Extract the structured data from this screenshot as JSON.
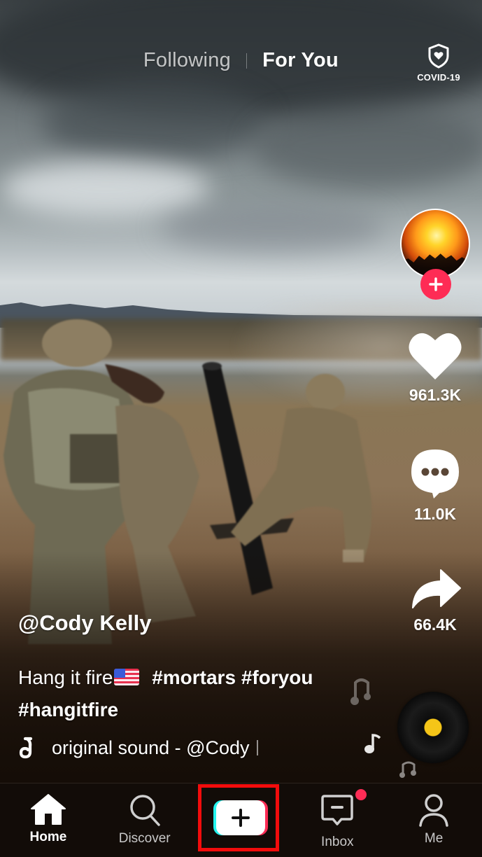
{
  "top_nav": {
    "tabs": [
      {
        "label": "Following",
        "active": false
      },
      {
        "label": "For You",
        "active": true
      }
    ],
    "covid_label": "COVID-19"
  },
  "creator": {
    "username": "@Cody Kelly",
    "follow_icon": "plus-icon"
  },
  "actions": {
    "likes": "961.3K",
    "comments": "11.0K",
    "shares": "66.4K"
  },
  "post": {
    "caption_text": "Hang it fire",
    "caption_emoji": "us-flag",
    "hashtags": [
      "#mortars",
      "#foryou",
      "#hangitfire"
    ],
    "sound": "original sound - @Cody"
  },
  "bottom_nav": {
    "items": [
      {
        "label": "Home",
        "icon": "home-icon",
        "active": true
      },
      {
        "label": "Discover",
        "icon": "search-icon",
        "active": false
      },
      {
        "label": "",
        "icon": "create-plus-icon",
        "active": false
      },
      {
        "label": "Inbox",
        "icon": "inbox-icon",
        "active": false,
        "has_notification": true
      },
      {
        "label": "Me",
        "icon": "profile-icon",
        "active": false
      }
    ]
  },
  "colors": {
    "accent_pink": "#fe2c55",
    "accent_cyan": "#25f4ee",
    "highlight_red": "#f20c0c",
    "disk_center": "#f5c518"
  }
}
